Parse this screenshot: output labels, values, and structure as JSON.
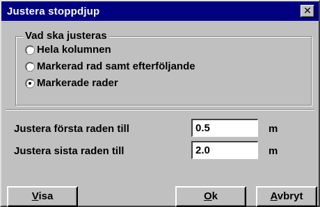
{
  "window": {
    "title": "Justera stoppdjup",
    "close_glyph": "✕"
  },
  "group": {
    "legend": "Vad ska justeras",
    "options": [
      {
        "label": "Hela kolumnen",
        "checked": false
      },
      {
        "label": "Markerad rad samt efterföljande",
        "checked": false
      },
      {
        "label": "Markerade rader",
        "checked": true
      }
    ]
  },
  "fields": {
    "first": {
      "label": "Justera första raden till",
      "value": "0.5",
      "unit": "m"
    },
    "last": {
      "label": "Justera sista raden till",
      "value": "2.0",
      "unit": "m"
    }
  },
  "buttons": {
    "visa": {
      "accel": "V",
      "rest": "isa"
    },
    "ok": {
      "accel": "O",
      "rest": "k"
    },
    "avbryt": {
      "accel": "A",
      "rest": "vbryt"
    }
  },
  "colors": {
    "titlebar": "#000080",
    "face": "#c0c0c0"
  }
}
